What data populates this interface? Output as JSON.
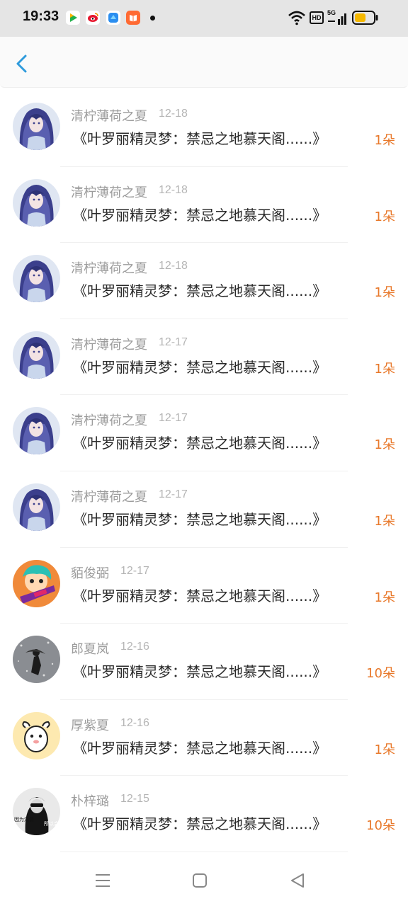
{
  "status_bar": {
    "time": "19:33",
    "app_icons": [
      "video-app-icon",
      "weibo-icon",
      "browser-icon",
      "reader-app-icon"
    ],
    "hd_label": "HD",
    "network_label": "5G",
    "battery_color": "#f5b800"
  },
  "header": {
    "back_icon": "chevron-left-icon",
    "accent_color": "#2f9bdc"
  },
  "gifts": [
    {
      "user": "清柠薄荷之夏",
      "date": "12-18",
      "book": "《叶罗丽精灵梦：禁忌之地慕天阁......》",
      "amount": "1朵",
      "avatar": "anime-girl"
    },
    {
      "user": "清柠薄荷之夏",
      "date": "12-18",
      "book": "《叶罗丽精灵梦：禁忌之地慕天阁......》",
      "amount": "1朵",
      "avatar": "anime-girl"
    },
    {
      "user": "清柠薄荷之夏",
      "date": "12-18",
      "book": "《叶罗丽精灵梦：禁忌之地慕天阁......》",
      "amount": "1朵",
      "avatar": "anime-girl"
    },
    {
      "user": "清柠薄荷之夏",
      "date": "12-17",
      "book": "《叶罗丽精灵梦：禁忌之地慕天阁......》",
      "amount": "1朵",
      "avatar": "anime-girl"
    },
    {
      "user": "清柠薄荷之夏",
      "date": "12-17",
      "book": "《叶罗丽精灵梦：禁忌之地慕天阁......》",
      "amount": "1朵",
      "avatar": "anime-girl"
    },
    {
      "user": "清柠薄荷之夏",
      "date": "12-17",
      "book": "《叶罗丽精灵梦：禁忌之地慕天阁......》",
      "amount": "1朵",
      "avatar": "anime-girl"
    },
    {
      "user": "貊俊弼",
      "date": "12-17",
      "book": "《叶罗丽精灵梦：禁忌之地慕天阁......》",
      "amount": "1朵",
      "avatar": "cartoon-boy"
    },
    {
      "user": "郎夏岚",
      "date": "12-16",
      "book": "《叶罗丽精灵梦：禁忌之地慕天阁......》",
      "amount": "10朵",
      "avatar": "snow-photo"
    },
    {
      "user": "厚紫夏",
      "date": "12-16",
      "book": "《叶罗丽精灵梦：禁忌之地慕天阁......》",
      "amount": "1朵",
      "avatar": "cartoon-sheep"
    },
    {
      "user": "朴梓璐",
      "date": "12-15",
      "book": "《叶罗丽精灵梦：禁忌之地慕天阁......》",
      "amount": "10朵",
      "avatar": "bw-portrait",
      "avatar_text_left": "因为深情",
      "avatar_text_right": "所以会"
    }
  ],
  "nav_bar": {
    "buttons": [
      "menu-icon",
      "home-square-icon",
      "back-triangle-icon"
    ]
  },
  "colors": {
    "amount": "#e8782a",
    "name": "#9c9c9c",
    "date": "#b5b5b5",
    "title": "#2a2a2a"
  }
}
